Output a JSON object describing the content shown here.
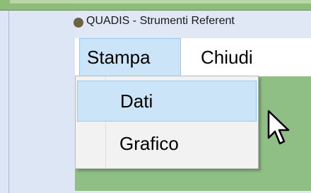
{
  "window": {
    "title": "QUADIS - Strumenti Referent"
  },
  "menu": {
    "stampa": "Stampa",
    "chiudi": "Chiudi"
  },
  "dropdown": {
    "items": [
      {
        "label": "Dati"
      },
      {
        "label": "Grafico"
      }
    ]
  },
  "icons": {
    "app": "app-icon",
    "cursor": "mouse-pointer-icon"
  },
  "colors": {
    "menu_highlight": "#cce4f7",
    "menu_highlight_border": "#99c9ef",
    "background_green": "#8fbf84",
    "chrome": "#dfe8f4"
  }
}
